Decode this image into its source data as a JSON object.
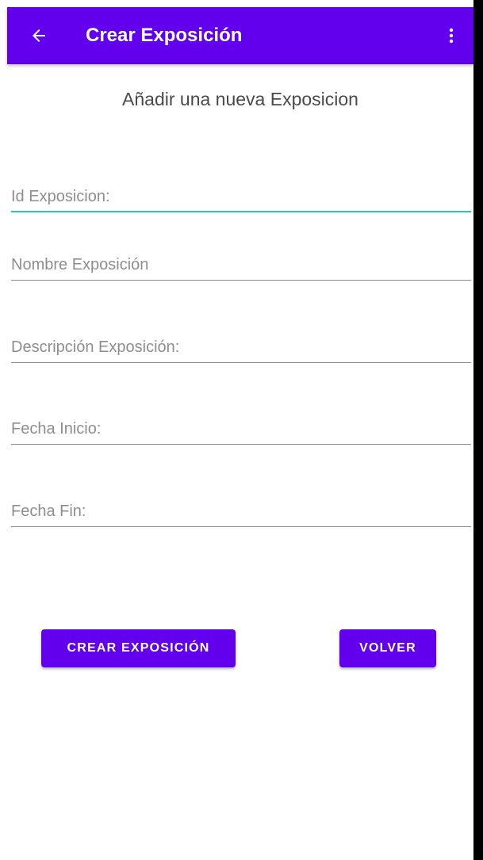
{
  "app_bar": {
    "title": "Crear Exposición",
    "back_icon": "arrow-left-icon",
    "menu_icon": "more-vert-icon",
    "color": "#6200ee"
  },
  "heading": "Añadir una nueva Exposicion",
  "form": {
    "id_placeholder": "Id Exposicion:",
    "name_placeholder": "Nombre Exposición",
    "description_placeholder": "Descripción Exposición:",
    "start_date_placeholder": "Fecha Inicio:",
    "end_date_placeholder": "Fecha Fin:",
    "focus_color": "#26c6b9"
  },
  "buttons": {
    "create_label": "CREAR EXPOSICIÓN",
    "back_label": "VOLVER"
  }
}
